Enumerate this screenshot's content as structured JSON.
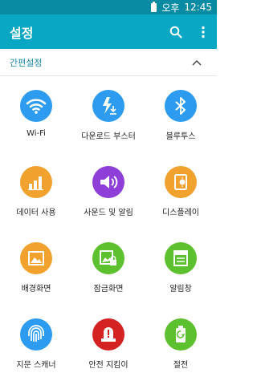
{
  "status_bar": {
    "ampm": "오후",
    "time": "12:45"
  },
  "app_bar": {
    "title": "설정",
    "search_icon": "search-icon",
    "more_icon": "more-vert-icon"
  },
  "section": {
    "title": "간편설정",
    "collapse_icon": "chevron-up-icon"
  },
  "colors": {
    "status_bar": "#0a8ba4",
    "app_bar": "#0aa7c4",
    "section_title": "#1a8aa4",
    "blue": "#2d9cf0",
    "orange": "#f0a12e",
    "purple": "#8e3fd8",
    "green": "#5dc02e",
    "red": "#d42222"
  },
  "tiles": [
    {
      "label": "Wi-Fi",
      "icon": "wifi-icon",
      "color": "#2d9cf0"
    },
    {
      "label": "다운로드 부스터",
      "icon": "download-booster-icon",
      "color": "#2d9cf0"
    },
    {
      "label": "블루투스",
      "icon": "bluetooth-icon",
      "color": "#2d9cf0"
    },
    {
      "label": "데이터 사용",
      "icon": "data-usage-icon",
      "color": "#f0a12e"
    },
    {
      "label": "사운드 및 알림",
      "icon": "sound-icon",
      "color": "#8e3fd8"
    },
    {
      "label": "디스플레이",
      "icon": "display-icon",
      "color": "#f0a12e"
    },
    {
      "label": "배경화면",
      "icon": "wallpaper-icon",
      "color": "#f0a12e"
    },
    {
      "label": "잠금화면",
      "icon": "lock-screen-icon",
      "color": "#5dc02e"
    },
    {
      "label": "알림창",
      "icon": "notification-panel-icon",
      "color": "#5dc02e"
    },
    {
      "label": "지문 스캐너",
      "icon": "fingerprint-icon",
      "color": "#2d9cf0"
    },
    {
      "label": "안전 지킴이",
      "icon": "emergency-icon",
      "color": "#d42222"
    },
    {
      "label": "절전",
      "icon": "power-saving-icon",
      "color": "#5dc02e"
    }
  ]
}
